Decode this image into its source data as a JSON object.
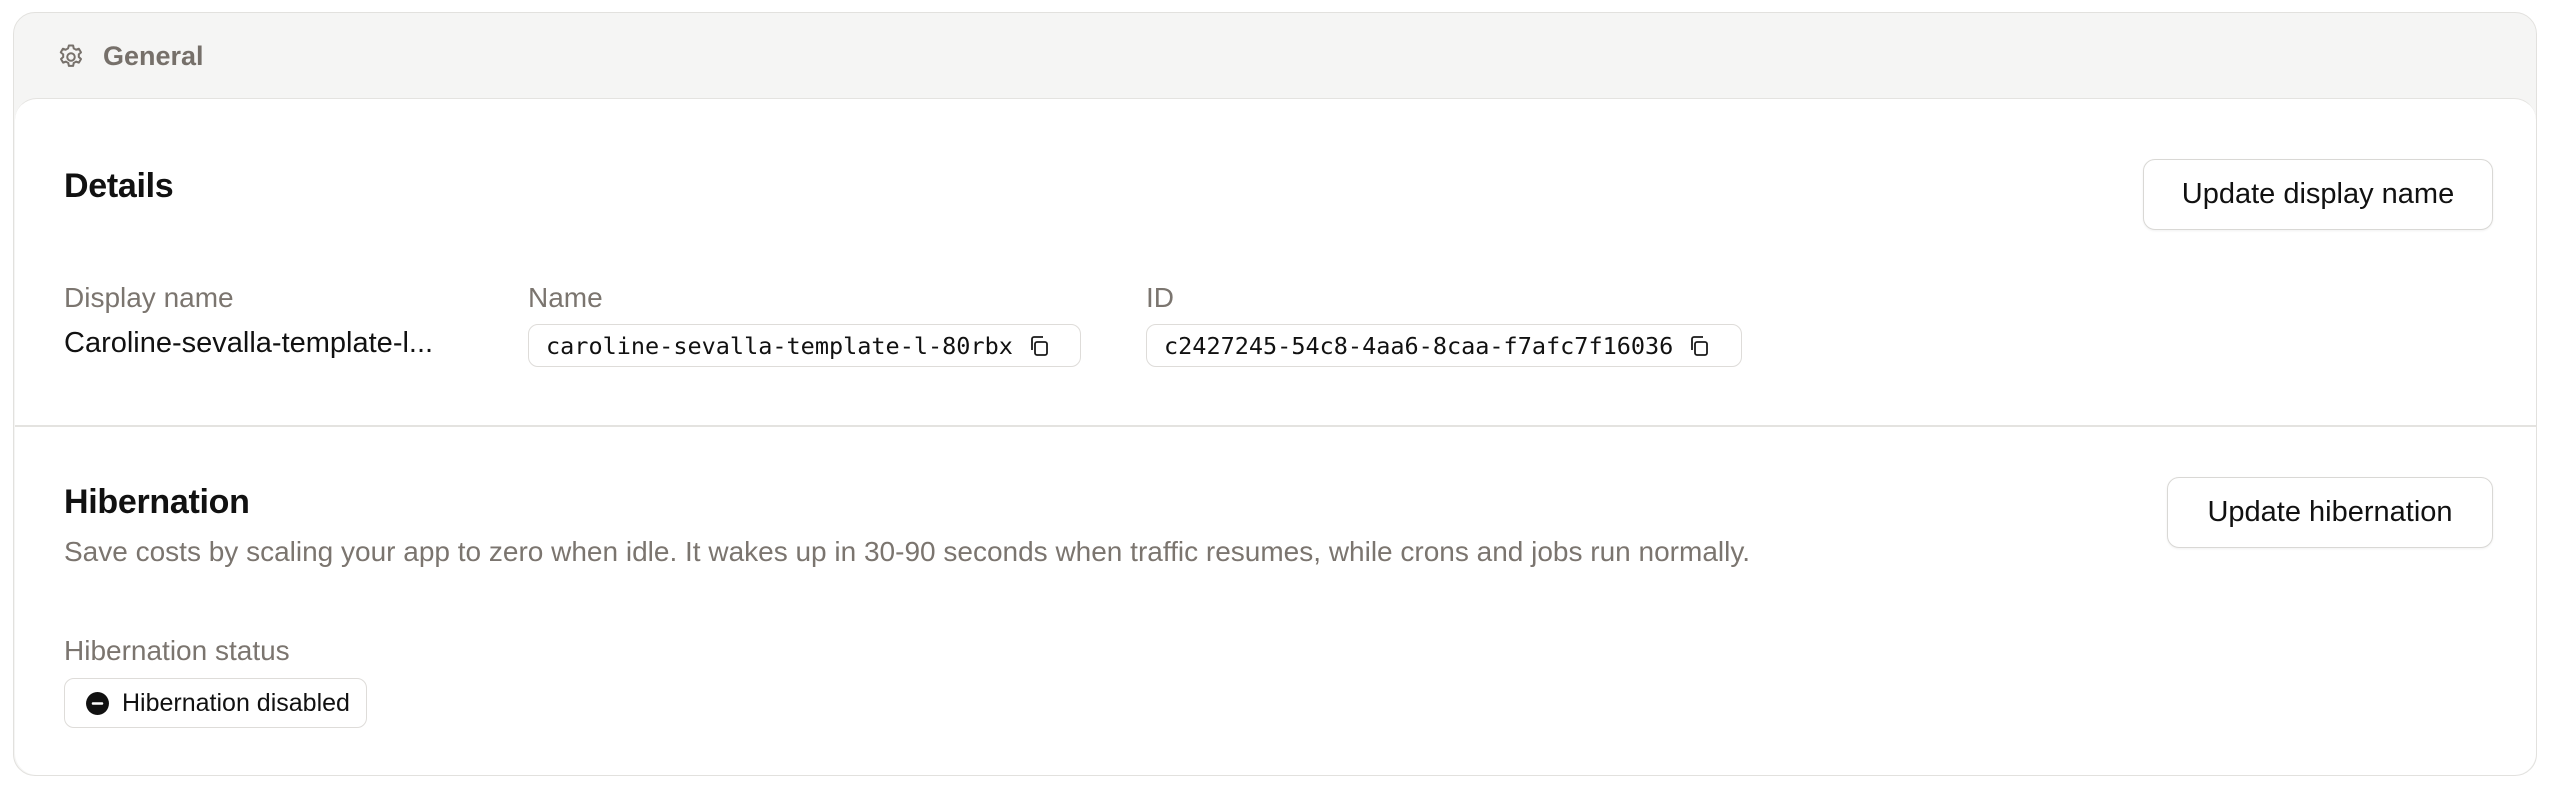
{
  "header": {
    "title": "General",
    "icon": "gear-icon"
  },
  "details": {
    "title": "Details",
    "update_button": "Update display name",
    "display_name_label": "Display name",
    "display_name_value": "Caroline-sevalla-template-l...",
    "name_label": "Name",
    "name_value": "caroline-sevalla-template-l-80rbx",
    "id_label": "ID",
    "id_value": "c2427245-54c8-4aa6-8caa-f7afc7f16036"
  },
  "hibernation": {
    "title": "Hibernation",
    "update_button": "Update hibernation",
    "description": "Save costs by scaling your app to zero when idle. It wakes up in 30-90 seconds when traffic resumes, while crons and jobs run normally.",
    "status_label": "Hibernation status",
    "status_value": "Hibernation disabled"
  }
}
